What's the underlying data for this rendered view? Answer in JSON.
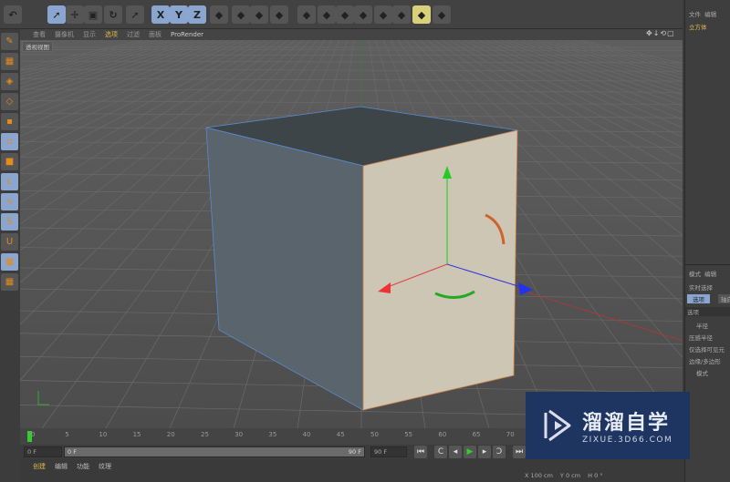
{
  "toolbar": {
    "buttons": [
      "undo-icon",
      "live-select-icon",
      "move-icon",
      "scale-icon",
      "rotate-icon",
      "recent-tool-icon",
      "X",
      "Y",
      "Z",
      "coordinate-system-icon",
      "render-view-icon",
      "render-picture-viewer-icon",
      "render-settings-icon",
      "cube-icon",
      "pen-icon",
      "subdivision-icon",
      "array-icon",
      "deformer-icon",
      "floor-icon",
      "camera-icon",
      "light-icon"
    ]
  },
  "viewport_menu": {
    "items": [
      "查看",
      "摄像机",
      "显示",
      "选项",
      "过滤",
      "面板",
      "ProRender"
    ],
    "active": "选项"
  },
  "viewport": {
    "label": "透视视图",
    "nav_icons": "✥↓⟲▢"
  },
  "left_tools": [
    "make-editable-icon",
    "model-mode-icon",
    "texture-mode-icon",
    "workplane-icon",
    "points-mode-icon",
    "edges-mode-icon",
    "polygons-mode-icon",
    "axis-icon",
    "tweak-icon",
    "snap-icon",
    "magnet-icon",
    "grid-lock-icon",
    "solo-icon"
  ],
  "objects_panel": {
    "menu": [
      "文件",
      "编辑"
    ],
    "object": "立方体"
  },
  "attributes_panel": {
    "menu": [
      "模式",
      "编辑"
    ],
    "tool": "实时选择",
    "tabs": [
      "选项",
      "轴向"
    ],
    "section": "选项",
    "fields": [
      "半径",
      "压感半径",
      "仅选择可见元",
      "边缘/多边形",
      "模式"
    ]
  },
  "timeline": {
    "ticks": [
      "0",
      "5",
      "10",
      "15",
      "20",
      "25",
      "30",
      "35",
      "40",
      "45",
      "50",
      "55",
      "60",
      "65",
      "70"
    ],
    "current": "0"
  },
  "controls": {
    "start": "0 F",
    "range_start": "0 F",
    "range_end": "90 F",
    "end": "90 F"
  },
  "bottom_menu": [
    "创建",
    "编辑",
    "功能",
    "纹理"
  ],
  "coords": {
    "x_label": "X",
    "x": "100 cm",
    "y_label": "Y",
    "y": "0 cm",
    "h_label": "H",
    "h": "0 °"
  },
  "watermark": {
    "title": "溜溜自学",
    "url": "ZIXUE.3D66.COM"
  },
  "colors": {
    "accent": "#8aa6cf",
    "cube_top": "#3d4548",
    "cube_left": "#5a646c",
    "cube_right": "#cdc6b4",
    "watermark": "#1e3461"
  }
}
